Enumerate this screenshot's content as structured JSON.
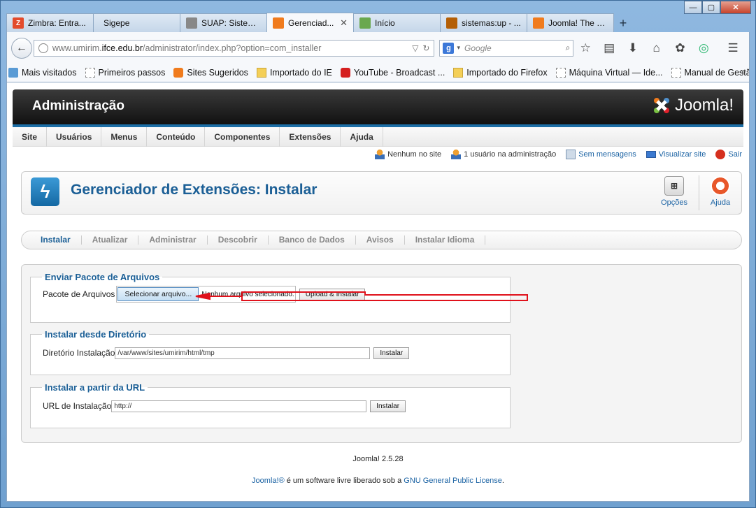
{
  "window": {
    "minimize": "—",
    "maximize": "▢",
    "close": "✕"
  },
  "tabs": [
    {
      "label": "Zimbra: Entra...",
      "icon_color": "#e34b2c",
      "icon_text": "Z"
    },
    {
      "label": "Sigepe",
      "icon_color": "",
      "icon_text": ""
    },
    {
      "label": "SUAP: Sistema...",
      "icon_color": "#888888",
      "icon_text": ""
    },
    {
      "label": "Gerenciad...",
      "icon_color": "#f07b1d",
      "icon_text": "",
      "active": true
    },
    {
      "label": "Início",
      "icon_color": "#6aa84f",
      "icon_text": ""
    },
    {
      "label": "sistemas:up - ...",
      "icon_color": "#b45f06",
      "icon_text": ""
    },
    {
      "label": "Joomla! The C...",
      "icon_color": "#f07b1d",
      "icon_text": ""
    }
  ],
  "navbar": {
    "url_prefix": "www.umirim.",
    "url_domain": "ifce.edu.br",
    "url_path": "/administrator/index.php?option=com_installer",
    "search_placeholder": "Google"
  },
  "bookmarks": [
    {
      "label": "Mais visitados",
      "icon": "star"
    },
    {
      "label": "Primeiros passos",
      "icon": "page"
    },
    {
      "label": "Sites Sugeridos",
      "icon": "gear"
    },
    {
      "label": "Importado do IE",
      "icon": "folder"
    },
    {
      "label": "YouTube - Broadcast ...",
      "icon": "yt"
    },
    {
      "label": "Importado do Firefox",
      "icon": "folder"
    },
    {
      "label": "Máquina Virtual — Ide...",
      "icon": "page"
    },
    {
      "label": "Manual de Gestão de ...",
      "icon": "page"
    }
  ],
  "joomla": {
    "admin_title": "Administração",
    "logo_text": "Joomla!",
    "menu": [
      "Site",
      "Usuários",
      "Menus",
      "Conteúdo",
      "Componentes",
      "Extensões",
      "Ajuda"
    ],
    "status": {
      "site_users": "Nenhum no site",
      "admin_users": "1 usuário na administração",
      "messages": "Sem mensagens",
      "view_site": "Visualizar site",
      "logout": "Sair"
    },
    "page_title": "Gerenciador de Extensões: Instalar",
    "toolbar": {
      "options": "Opções",
      "help": "Ajuda"
    },
    "subnav": [
      "Instalar",
      "Atualizar",
      "Administrar",
      "Descobrir",
      "Banco de Dados",
      "Avisos",
      "Instalar Idioma"
    ],
    "upload": {
      "legend": "Enviar Pacote de Arquivos",
      "label": "Pacote de Arquivos",
      "file_button": "Selecionar arquivo...",
      "file_status": "Nenhum arquivo selecionado.",
      "submit": "Upload & Instalar"
    },
    "directory": {
      "legend": "Instalar desde Diretório",
      "label": "Diretório Instalação",
      "value": "/var/www/sites/umirim/html/tmp",
      "submit": "Instalar"
    },
    "url_install": {
      "legend": "Instalar a partir da URL",
      "label": "URL de Instalação",
      "value": "http://",
      "submit": "Instalar"
    },
    "version": "Joomla! 2.5.28",
    "license_link1": "Joomla!®",
    "license_mid": " é um software livre liberado sob a ",
    "license_link2": "GNU General Public License",
    "license_end": "."
  },
  "annotation_color": "#e0111b"
}
